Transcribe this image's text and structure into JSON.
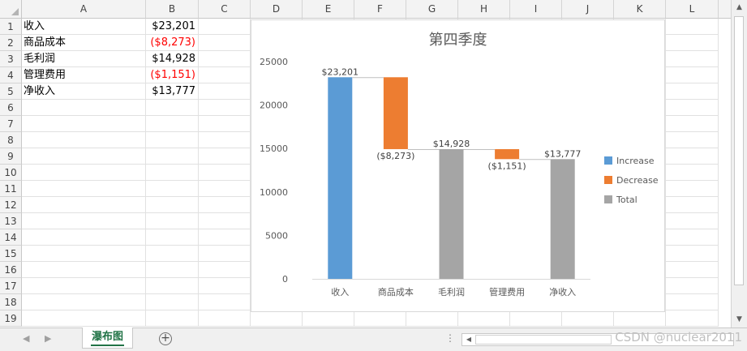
{
  "columns": [
    "A",
    "B",
    "C",
    "D",
    "E",
    "F",
    "G",
    "H",
    "I",
    "J",
    "K",
    "L"
  ],
  "rows": [
    "1",
    "2",
    "3",
    "4",
    "5",
    "6",
    "7",
    "8",
    "9",
    "10",
    "11",
    "12",
    "13",
    "14",
    "15",
    "16",
    "17",
    "18",
    "19"
  ],
  "cells": [
    {
      "label": "收入",
      "value": "$23,201",
      "negative": false
    },
    {
      "label": "商品成本",
      "value": "($8,273)",
      "negative": true
    },
    {
      "label": "毛利润",
      "value": "$14,928",
      "negative": false
    },
    {
      "label": "管理费用",
      "value": "($1,151)",
      "negative": true
    },
    {
      "label": "净收入",
      "value": "$13,777",
      "negative": false
    }
  ],
  "chart_data": {
    "type": "bar",
    "subtype": "waterfall",
    "title": "第四季度",
    "categories": [
      "收入",
      "商品成本",
      "毛利润",
      "管理费用",
      "净收入"
    ],
    "values": [
      23201,
      -8273,
      14928,
      -1151,
      13777
    ],
    "kinds": [
      "increase",
      "decrease",
      "total",
      "decrease",
      "total"
    ],
    "data_labels": [
      "$23,201",
      "($8,273)",
      "$14,928",
      "($1,151)",
      "$13,777"
    ],
    "ylim": [
      0,
      25000
    ],
    "yticks": [
      0,
      5000,
      10000,
      15000,
      20000,
      25000
    ],
    "legend": [
      "Increase",
      "Decrease",
      "Total"
    ],
    "legend_position": "right",
    "grid": false,
    "colors": {
      "increase": "#5b9bd5",
      "decrease": "#ed7d31",
      "total": "#a5a5a5"
    }
  },
  "sheet_tab": "瀑布图",
  "add_sheet_symbol": "+",
  "tab_options_symbol": "⋮",
  "watermark": "CSDN @nuclear2011"
}
